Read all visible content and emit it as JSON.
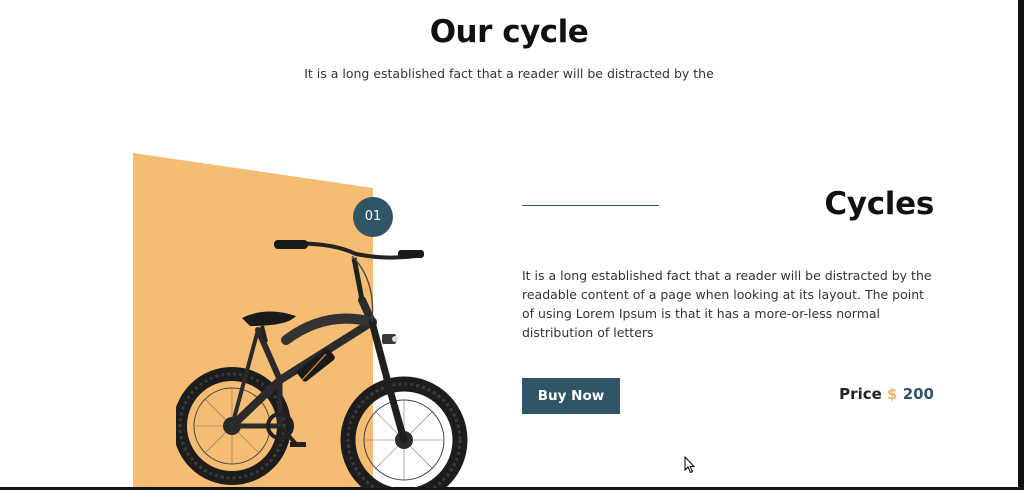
{
  "section": {
    "title": "Our cycle",
    "subtitle": "It is a long established fact that a reader will be distracted by the"
  },
  "product": {
    "number": "01",
    "title": "Cycles",
    "description": "It is a long established fact that a reader will be distracted by the readable content of a page when looking at its layout. The point of using Lorem Ipsum is that it has a more-or-less normal distribution of letters",
    "buy_label": "Buy Now",
    "price_label": "Price",
    "currency": "$",
    "price_value": "200"
  },
  "colors": {
    "accent": "#2f5566",
    "panel": "#f5bc73",
    "price_currency": "#f2b66a"
  }
}
